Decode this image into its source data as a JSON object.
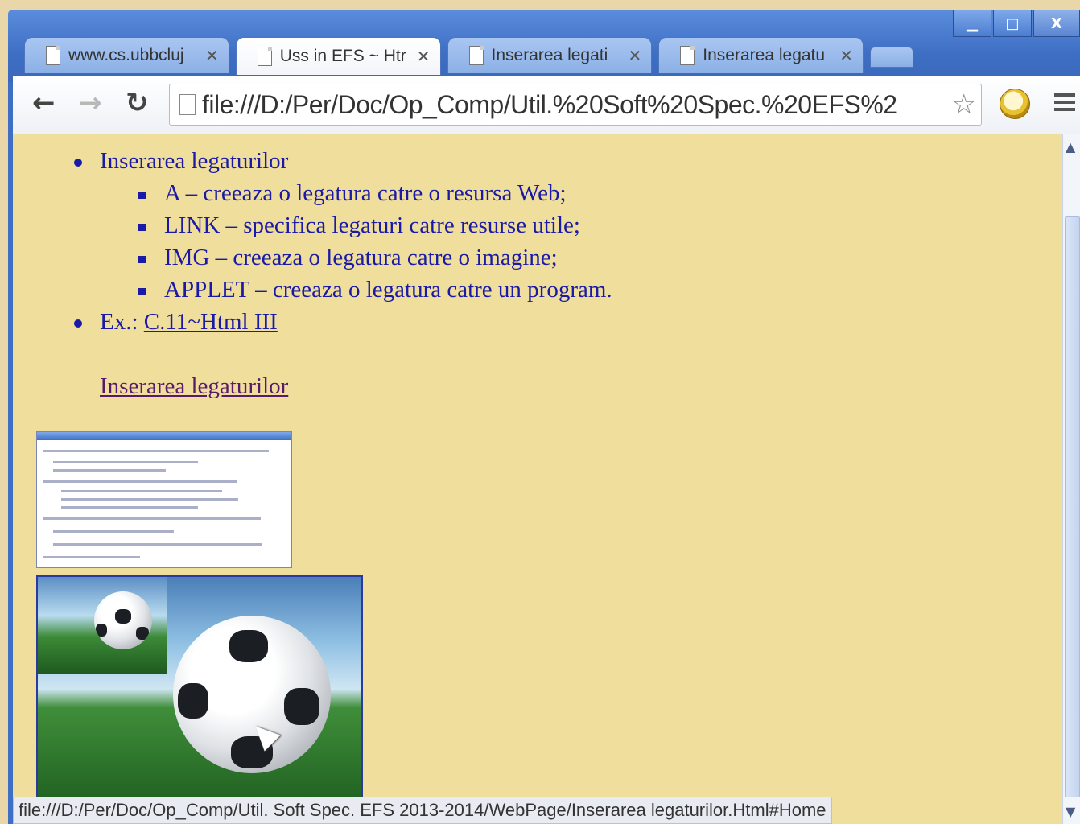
{
  "browser": {
    "tabs": [
      {
        "title": "www.cs.ubbcluj",
        "active": false
      },
      {
        "title": "Uss in EFS ~ Htr",
        "active": true
      },
      {
        "title": "Inserarea legati",
        "active": false
      },
      {
        "title": "Inserarea legatu",
        "active": false
      }
    ],
    "tab_close_glyph": "✕",
    "address": "file:///D:/Per/Doc/Op_Comp/Util.%20Soft%20Spec.%20EFS%2",
    "window_controls": {
      "minimize": "▁",
      "maximize": "□",
      "close": "X"
    },
    "icons": {
      "back": "back-arrow-icon",
      "forward": "forward-arrow-icon",
      "reload": "reload-icon",
      "star": "star-icon",
      "extension": "alarm-clock-icon",
      "menu": "hamburger-menu-icon"
    }
  },
  "page": {
    "items": [
      {
        "text": "Inserarea legaturilor"
      },
      {
        "text": "A – creeaza o legatura catre o resursa Web;"
      },
      {
        "text": "LINK – specifica legaturi catre resurse utile;"
      },
      {
        "text": "IMG – creeaza o legatura catre o imagine;"
      },
      {
        "text": "APPLET – creeaza o legatura catre un program."
      }
    ],
    "example_label": "Ex.:",
    "example_link": "C.11~Html III",
    "section_link": "Inserarea legaturilor"
  },
  "status_bar": "file:///D:/Per/Doc/Op_Comp/Util. Soft Spec. EFS 2013-2014/WebPage/Inserarea legaturilor.Html#Home",
  "colors": {
    "page_background": "#f0de9d",
    "text": "#1a1aa6",
    "frame": "#3e6fc4"
  }
}
